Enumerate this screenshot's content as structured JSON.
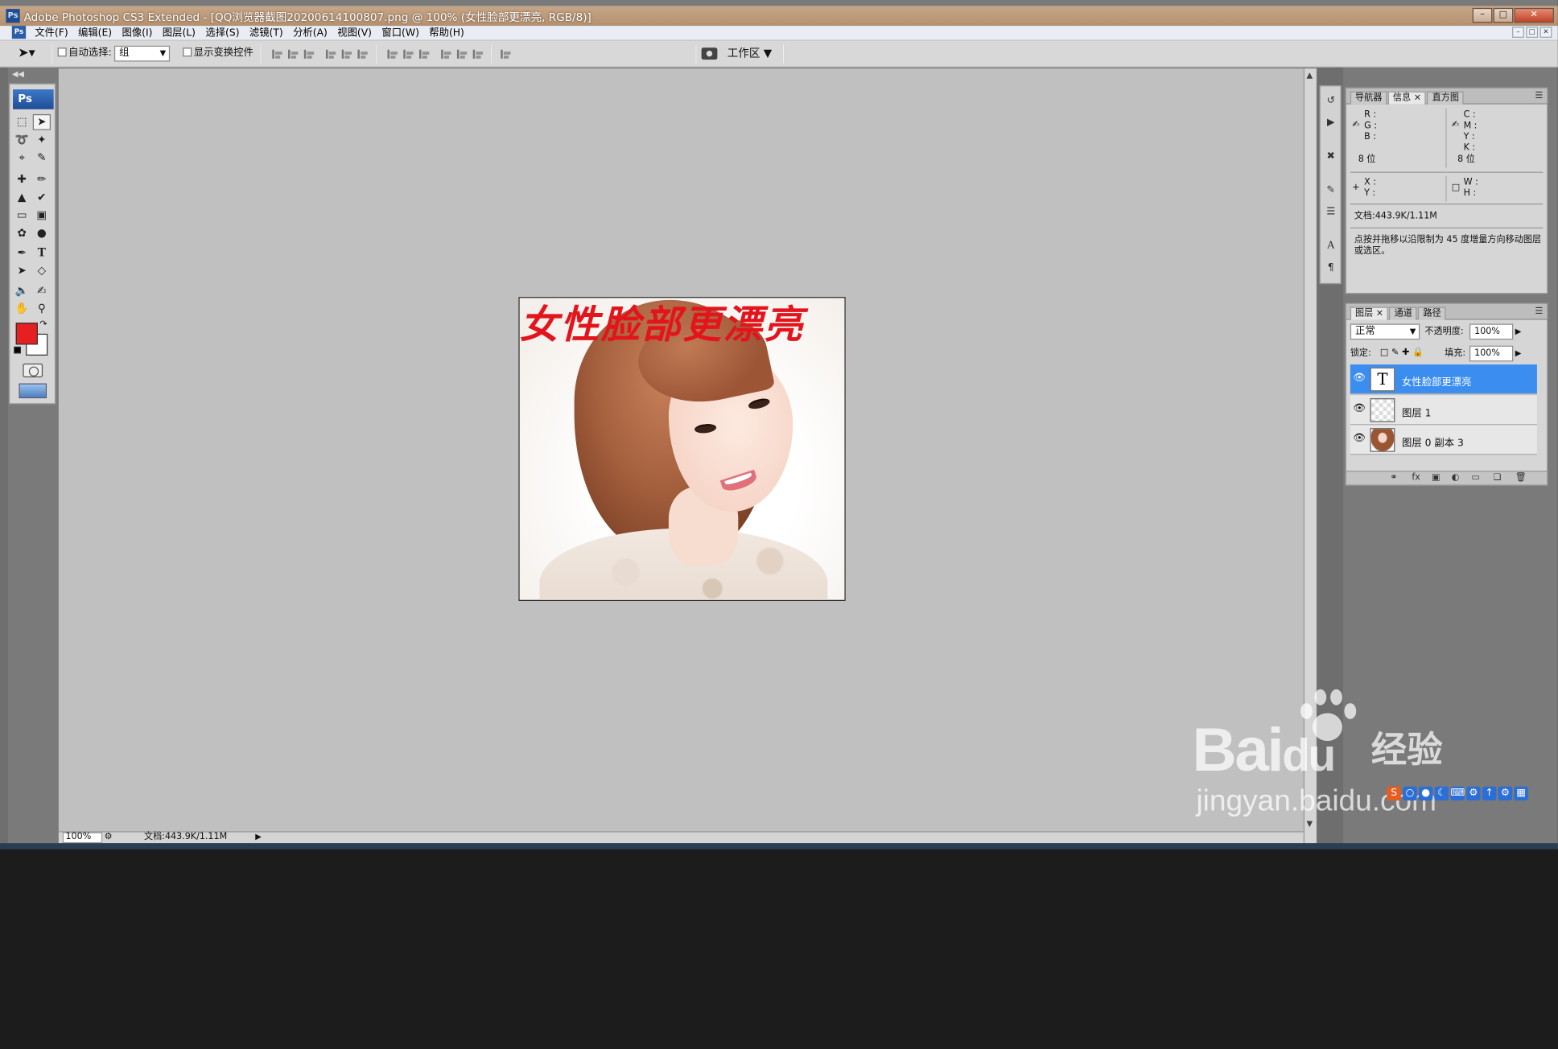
{
  "window": {
    "title": "Adobe Photoshop CS3 Extended - [QQ浏览器截图20200614100807.png @ 100% (女性脸部更漂亮, RGB/8)]",
    "controls": [
      "minimize",
      "maximize",
      "close"
    ]
  },
  "menubar": {
    "items": [
      "文件(F)",
      "编辑(E)",
      "图像(I)",
      "图层(L)",
      "选择(S)",
      "滤镜(T)",
      "分析(A)",
      "视图(V)",
      "窗口(W)",
      "帮助(H)"
    ]
  },
  "options": {
    "auto_select_label": "自动选择:",
    "auto_select_value": "组",
    "show_transform_label": "显示变换控件",
    "workspace_label": "工作区"
  },
  "toolbox": {
    "logo": "Ps",
    "foreground_color": "#e62020",
    "background_color": "#ffffff"
  },
  "document": {
    "text_layer": "女性脸部更漂亮",
    "text_color": "#e3141b"
  },
  "statusbar": {
    "zoom": "100%",
    "doc_info": "文档:443.9K/1.11M"
  },
  "info_panel": {
    "tabs": [
      "导航器",
      "信息",
      "直方图"
    ],
    "active_tab": "信息",
    "rgb_labels": [
      "R :",
      "G :",
      "B :"
    ],
    "cmyk_labels": [
      "C :",
      "M :",
      "Y :",
      "K :"
    ],
    "bit_left": "8 位",
    "bit_right": "8 位",
    "xy_labels": [
      "X :",
      "Y :"
    ],
    "wh_labels": [
      "W :",
      "H :"
    ],
    "doc_size": "文档:443.9K/1.11M",
    "hint": "点按并拖移以沿限制为 45 度增量方向移动图层或选区。"
  },
  "layers_panel": {
    "tabs": [
      "图层",
      "通道",
      "路径"
    ],
    "active_tab": "图层",
    "blend_mode": "正常",
    "opacity_label": "不透明度:",
    "opacity_value": "100%",
    "lock_label": "锁定:",
    "fill_label": "填充:",
    "fill_value": "100%",
    "layers": [
      {
        "name": "女性脸部更漂亮",
        "type": "text",
        "selected": true
      },
      {
        "name": "图层 1",
        "type": "transparent",
        "selected": false
      },
      {
        "name": "图层 0 副本 3",
        "type": "photo",
        "selected": false
      }
    ]
  },
  "watermark": {
    "brand": "Bai",
    "brand_tail": "du",
    "brand_cn": "经验",
    "url": "jingyan.baidu.com"
  },
  "icons": [
    "move-tool-icon",
    "marquee-icon",
    "lasso-icon",
    "magic-wand-icon",
    "crop-icon",
    "eyedropper-icon",
    "healing-brush-icon",
    "brush-icon",
    "stamp-icon",
    "history-brush-icon",
    "eraser-icon",
    "gradient-icon",
    "blur-icon",
    "dodge-icon",
    "pen-icon",
    "type-icon",
    "path-select-icon",
    "shape-icon",
    "hand-icon",
    "zoom-icon",
    "eye-icon"
  ]
}
